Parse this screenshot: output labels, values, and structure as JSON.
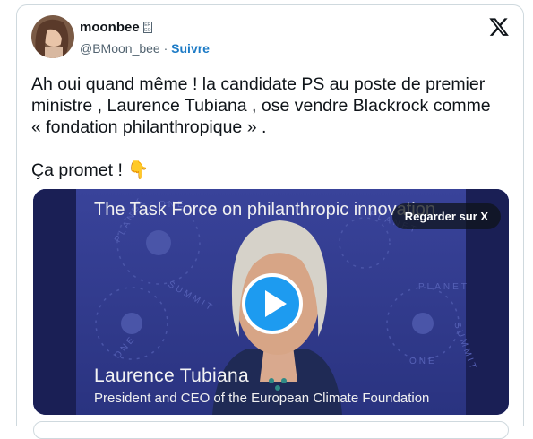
{
  "author": {
    "name": "moonbee",
    "badge": "ER GO",
    "handle": "@BMoon_bee",
    "separator": "·",
    "follow_label": "Suivre"
  },
  "header": {
    "logo_icon": "x-logo-icon"
  },
  "tweet": {
    "text": "Ah oui quand même ! la candidate PS au poste de premier\nministre , Laurence Tubiana , ose vendre Blackrock comme\n« fondation philanthropique » .\n\nÇa promet ! 👇"
  },
  "media": {
    "overlay_title": "The Task Force on philanthropic innovation",
    "watch_label": "Regarder sur X",
    "play_icon": "play-icon",
    "lower_third_name": "Laurence  Tubiana",
    "lower_third_role": "President and CEO of the European Climate Foundation",
    "background_words": [
      "ONE",
      "PLANET",
      "SUMMIT"
    ],
    "accent_color": "#1d9bf0",
    "background_color": "#2f3a8c"
  }
}
